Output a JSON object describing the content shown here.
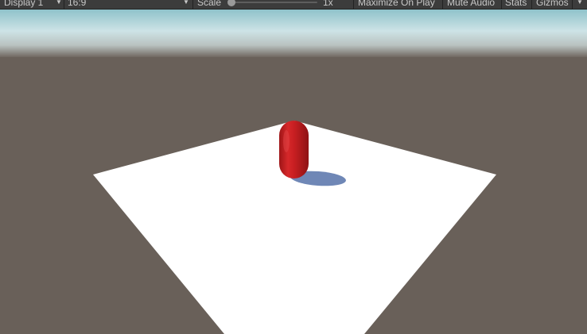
{
  "toolbar": {
    "display_label": "Display 1",
    "aspect_label": "16:9",
    "scale_label": "Scale",
    "scale_value": "1x",
    "scale_fraction": 0.0,
    "maximize_label": "Maximize On Play",
    "mute_label": "Mute Audio",
    "stats_label": "Stats",
    "gizmos_label": "Gizmos"
  },
  "icons": {
    "dropdown": "chevron-down-icon",
    "slider": "scale-slider-thumb"
  },
  "colors": {
    "toolbar_bg": "#3c3c3c",
    "toolbar_text": "#c8c8c8",
    "ground": "#696059",
    "sky_top": "#9fcbd1",
    "plane": "#ffffff",
    "capsule": "#c41f22",
    "shadow": "#6f87b6"
  }
}
